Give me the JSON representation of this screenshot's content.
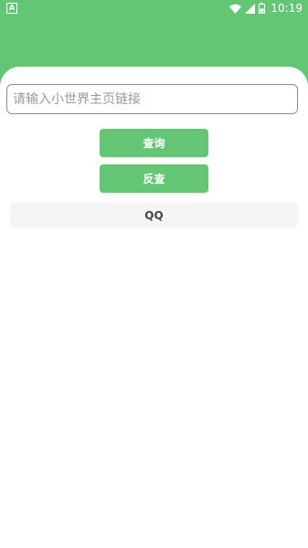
{
  "status_bar": {
    "left_icon_glyph": "A",
    "time": "10:19",
    "icons": [
      "wifi-icon",
      "signal-icon",
      "battery-icon"
    ]
  },
  "search": {
    "placeholder": "请输入小世界主页链接",
    "value": ""
  },
  "buttons": {
    "query_label": "查询",
    "reverse_label": "反查"
  },
  "qq_bar": {
    "label": "QQ"
  },
  "colors": {
    "primary": "#64c574",
    "input_border": "#8c8c8c",
    "qq_bar_bg": "#f5f5f5"
  }
}
